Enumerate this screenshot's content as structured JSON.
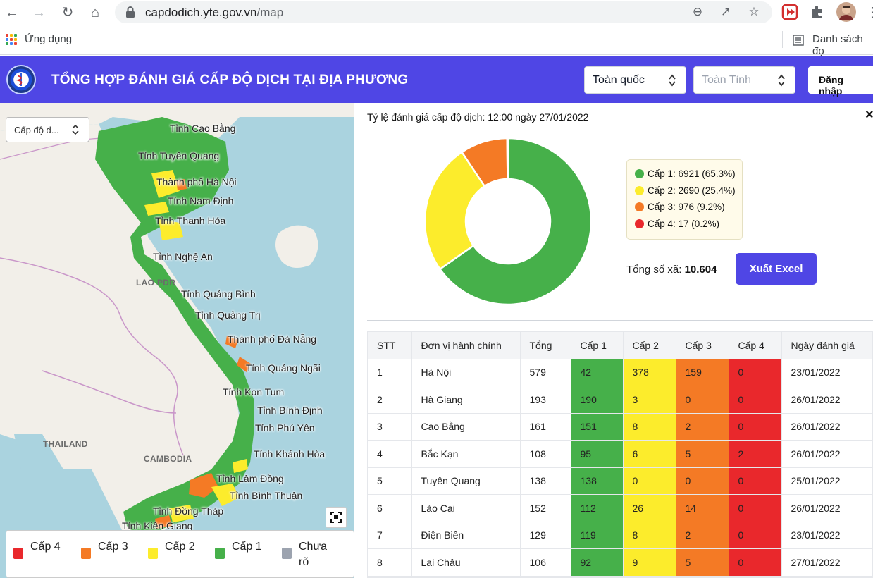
{
  "browser": {
    "url_host": "capdodich.yte.gov.vn",
    "url_path": "/map",
    "bookmark_apps": "Ứng dụng",
    "bookmark_list": "Danh sách đọ"
  },
  "header": {
    "title": "TỔNG HỢP ĐÁNH GIÁ CẤP ĐỘ DỊCH TẠI ĐỊA PHƯƠNG",
    "scope_select": "Toàn quốc",
    "province_select": "Toàn Tỉnh",
    "login": "Đăng nhập"
  },
  "map": {
    "layer_select": "Cấp độ d...",
    "labels": [
      "Tỉnh Cao Bằng",
      "Tỉnh Tuyên Quang",
      "Thành phố Hà Nội",
      "Tỉnh Nam Định",
      "Tỉnh Thanh Hóa",
      "Tỉnh Nghệ An",
      "Tỉnh Quảng Bình",
      "Tỉnh Quảng Trị",
      "Thành phố Đà Nẵng",
      "Tỉnh Quảng Ngãi",
      "Tỉnh Kon Tum",
      "Tỉnh Bình Định",
      "Tỉnh Phú Yên",
      "Tỉnh Khánh Hòa",
      "Tỉnh Lâm Đồng",
      "Tỉnh Bình Thuận",
      "Tỉnh Đồng Tháp",
      "Tỉnh Kiên Giang"
    ],
    "countries": [
      "LAO PDR",
      "THAILAND",
      "CAMBODIA"
    ],
    "legend": [
      {
        "label": "Cấp 4",
        "color": "#e9282c"
      },
      {
        "label": "Cấp 3",
        "color": "#f47a25"
      },
      {
        "label": "Cấp 2",
        "color": "#fcec2c"
      },
      {
        "label": "Cấp 1",
        "color": "#46b04a"
      },
      {
        "label": "Chưa rõ",
        "color": "#9ca3af"
      }
    ]
  },
  "summary": {
    "rate_title": "Tỷ lệ đánh giá cấp độ dịch: 12:00 ngày 27/01/2022",
    "total_label": "Tổng số xã:",
    "total_value": "10.604",
    "export_button": "Xuất Excel"
  },
  "chart_data": {
    "type": "pie",
    "categories": [
      "Cấp 1",
      "Cấp 2",
      "Cấp 3",
      "Cấp 4"
    ],
    "values": [
      6921,
      2690,
      976,
      17
    ],
    "percent": [
      65.3,
      25.4,
      9.2,
      0.2
    ],
    "colors": [
      "#46b04a",
      "#fcec2c",
      "#f47a25",
      "#e9282c"
    ],
    "legend_entries": [
      "Cấp 1: 6921 (65.3%)",
      "Cấp 2: 2690 (25.4%)",
      "Cấp 3: 976 (9.2%)",
      "Cấp 4: 17 (0.2%)"
    ]
  },
  "table": {
    "headers": [
      "STT",
      "Đơn vị hành chính",
      "Tổng",
      "Cấp 1",
      "Cấp 2",
      "Cấp 3",
      "Cấp 4",
      "Ngày đánh giá"
    ],
    "rows": [
      [
        "1",
        "Hà Nội",
        "579",
        "42",
        "378",
        "159",
        "0",
        "23/01/2022"
      ],
      [
        "2",
        "Hà Giang",
        "193",
        "190",
        "3",
        "0",
        "0",
        "26/01/2022"
      ],
      [
        "3",
        "Cao Bằng",
        "161",
        "151",
        "8",
        "2",
        "0",
        "26/01/2022"
      ],
      [
        "4",
        "Bắc Kạn",
        "108",
        "95",
        "6",
        "5",
        "2",
        "26/01/2022"
      ],
      [
        "5",
        "Tuyên Quang",
        "138",
        "138",
        "0",
        "0",
        "0",
        "25/01/2022"
      ],
      [
        "6",
        "Lào Cai",
        "152",
        "112",
        "26",
        "14",
        "0",
        "26/01/2022"
      ],
      [
        "7",
        "Điện Biên",
        "129",
        "119",
        "8",
        "2",
        "0",
        "23/01/2022"
      ],
      [
        "8",
        "Lai Châu",
        "106",
        "92",
        "9",
        "5",
        "0",
        "27/01/2022"
      ]
    ]
  }
}
